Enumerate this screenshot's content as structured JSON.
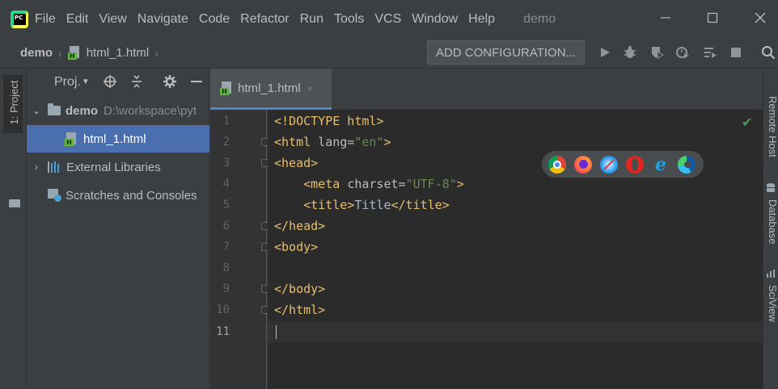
{
  "menubar": {
    "items": [
      "File",
      "Edit",
      "View",
      "Navigate",
      "Code",
      "Refactor",
      "Run",
      "Tools",
      "VCS",
      "Window",
      "Help"
    ],
    "window_title": "demo"
  },
  "navbar": {
    "project": "demo",
    "file": "html_1.html",
    "add_configuration": "ADD CONFIGURATION..."
  },
  "left_stripe": {
    "project_label": "1: Project"
  },
  "project_panel": {
    "title": "Proj.",
    "tree": {
      "root_name": "demo",
      "root_path": "D:\\workspace\\pyt",
      "file": "html_1.html",
      "external_libraries": "External Libraries",
      "scratches": "Scratches and Consoles"
    }
  },
  "editor": {
    "tab_label": "html_1.html",
    "tab_close": "×",
    "line_numbers": [
      "1",
      "2",
      "3",
      "4",
      "5",
      "6",
      "7",
      "8",
      "9",
      "10",
      "11"
    ],
    "lines": {
      "l1": "<!DOCTYPE html>",
      "l2_open": "<html ",
      "l2_attr": "lang=",
      "l2_val": "\"en\"",
      "l2_close": ">",
      "l3": "<head>",
      "l4_open": "    <meta ",
      "l4_attr": "charset=",
      "l4_val": "\"UTF-8\"",
      "l4_close": ">",
      "l5_open": "    <title>",
      "l5_text": "Title",
      "l5_close": "</title>",
      "l6": "</head>",
      "l7": "<body>",
      "l9": "</body>",
      "l10": "</html>"
    },
    "current_line": 11
  },
  "browser_popup": {
    "browsers": [
      "chrome",
      "firefox",
      "safari",
      "opera",
      "internet-explorer",
      "edge"
    ]
  },
  "right_stripe": {
    "labels": [
      "Remote Host",
      "Database",
      "SciView"
    ]
  },
  "colors": {
    "tag": "#e8bf6a",
    "attribute": "#bababa",
    "string": "#6a8759",
    "text": "#a9b7c6",
    "selection": "#4b6eaf",
    "editor_bg": "#2b2b2b"
  }
}
